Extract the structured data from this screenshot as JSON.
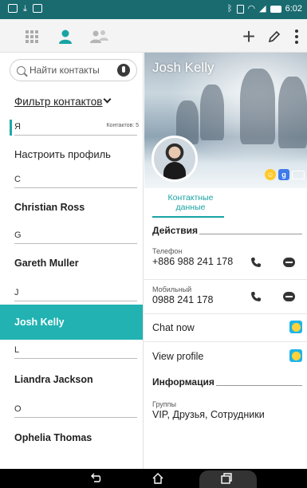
{
  "status_bar": {
    "time": "6:02",
    "left_icons": [
      "screenshot-icon",
      "download-icon",
      "image-icon"
    ],
    "right_icons": [
      "bluetooth-icon",
      "vibrate-icon",
      "wifi-icon",
      "signal-icon",
      "battery-icon"
    ]
  },
  "toolbar": {
    "tabs": [
      "apps-grid-icon",
      "contacts-person-icon",
      "groups-icon"
    ],
    "actions": [
      "add-icon",
      "edit-icon",
      "more-icon"
    ]
  },
  "sidebar": {
    "search_placeholder": "Найти контакты",
    "filter_label": "Фильтр контактов",
    "contacts_count": "Контактов: 5",
    "rows": [
      {
        "type": "letter",
        "text": "Я"
      },
      {
        "type": "name",
        "text": "Настроить профиль",
        "plain": true
      },
      {
        "type": "letter",
        "text": "C"
      },
      {
        "type": "name",
        "text": "Christian Ross"
      },
      {
        "type": "letter",
        "text": "G"
      },
      {
        "type": "name",
        "text": "Gareth Muller"
      },
      {
        "type": "letter",
        "text": "J"
      },
      {
        "type": "name",
        "text": "Josh Kelly",
        "active": true
      },
      {
        "type": "letter",
        "text": "L"
      },
      {
        "type": "name",
        "text": "Liandra Jackson"
      },
      {
        "type": "letter",
        "text": "O"
      },
      {
        "type": "name",
        "text": "Ophelia Thomas"
      }
    ]
  },
  "detail": {
    "name": "Josh Kelly",
    "tab_label": "Контактные данные",
    "actions_header": "Действия",
    "phone_label": "Телефон",
    "phone_value": "+886 988 241 178",
    "mobile_label": "Мобильный",
    "mobile_value": "0988 241 178",
    "chat_now": "Chat now",
    "view_profile": "View profile",
    "info_header": "Информация",
    "groups_label": "Группы",
    "groups_value": "VIP, Друзья, Сотрудники"
  },
  "colors": {
    "accent": "#22b2b2",
    "status_bar": "#1a6b70"
  }
}
